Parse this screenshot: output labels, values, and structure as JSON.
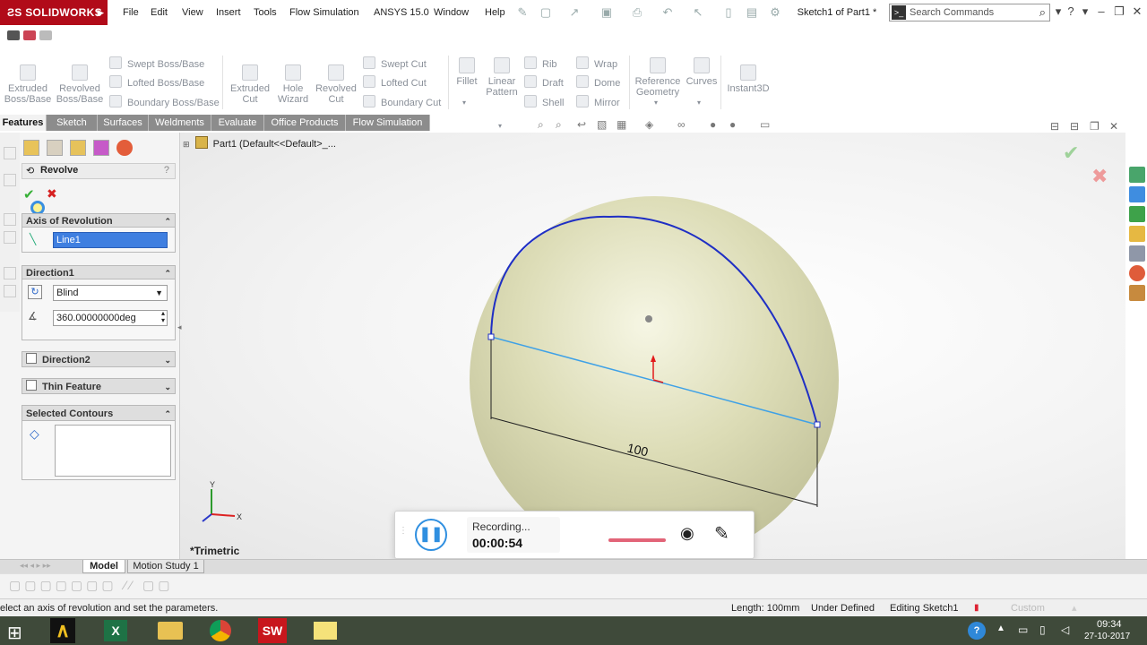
{
  "app": {
    "logo_text": "SOLIDWORKS",
    "document_title": "Sketch1 of Part1 *"
  },
  "menu": [
    "File",
    "Edit",
    "View",
    "Insert",
    "Tools",
    "Flow Simulation",
    "ANSYS 15.0",
    "Window",
    "Help"
  ],
  "search": {
    "placeholder": "Search Commands"
  },
  "ribbon": {
    "extruded_boss": "Extruded Boss/Base",
    "revolved_boss": "Revolved Boss/Base",
    "swept_boss": "Swept Boss/Base",
    "lofted_boss": "Lofted Boss/Base",
    "boundary_boss": "Boundary Boss/Base",
    "extruded_cut": "Extruded Cut",
    "hole_wizard": "Hole Wizard",
    "revolved_cut": "Revolved Cut",
    "swept_cut": "Swept Cut",
    "lofted_cut": "Lofted Cut",
    "boundary_cut": "Boundary Cut",
    "fillet": "Fillet",
    "linear_pattern": "Linear Pattern",
    "rib": "Rib",
    "draft": "Draft",
    "shell": "Shell",
    "wrap": "Wrap",
    "dome": "Dome",
    "mirror": "Mirror",
    "reference_geometry": "Reference Geometry",
    "curves": "Curves",
    "instant3d": "Instant3D"
  },
  "tabs": [
    "Features",
    "Sketch",
    "Surfaces",
    "Weldments",
    "Evaluate",
    "Office Products",
    "Flow Simulation"
  ],
  "active_tab": "Features",
  "feature_tree": {
    "root": "Part1  (Default<<Default>_..."
  },
  "property_manager": {
    "title": "Revolve",
    "help": "?",
    "axis_section": "Axis of Revolution",
    "axis_value": "Line1",
    "direction1_section": "Direction1",
    "direction1_type": "Blind",
    "direction1_angle": "360.00000000deg",
    "direction2_section": "Direction2",
    "thin_feature_section": "Thin Feature",
    "selected_contours_section": "Selected Contours"
  },
  "viewport": {
    "dimension_label": "100",
    "view_label": "*Trimetric",
    "triad": {
      "x": "X",
      "y": "Y"
    }
  },
  "recorder": {
    "status": "Recording...",
    "elapsed": "00:00:54"
  },
  "bottom_tabs": [
    "Model",
    "Motion Study 1"
  ],
  "status_bar": {
    "hint": "elect an axis of revolution and set the parameters.",
    "length": "Length: 100mm",
    "definition": "Under Defined",
    "editing": "Editing Sketch1",
    "custom": "Custom"
  },
  "taskbar": {
    "time": "09:34",
    "date": "27-10-2017"
  },
  "colors": {
    "brand": "#b10b19",
    "sketch_arc": "#1f2fc4",
    "sketch_line": "#3fa1e6",
    "sphere": "#dcdcb6",
    "recorder_accent": "#2f8fe0"
  }
}
